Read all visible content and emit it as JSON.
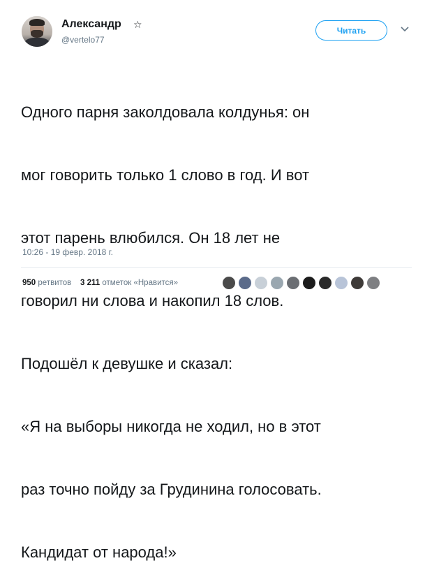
{
  "tweet": {
    "author_name": "Александр",
    "verified_icon": "☆",
    "handle": "@vertelo77",
    "follow_label": "Читать",
    "text_lines": [
      "Одного парня заколдовала колдунья: он",
      "мог говорить только 1 слово в год. И вот",
      "этот парень влюбился. Он 18 лет не",
      "говорил ни слова и накопил 18 слов.",
      "Подошёл к девушке и сказал:",
      "«Я на выборы никогда не ходил, но в этот",
      "раз точно пойду за Грудинина голосовать.",
      "Кандидат от народа!»"
    ],
    "timestamp": "10:26 - 19 февр. 2018 г.",
    "retweets_count": "950",
    "retweets_label": "ретвитов",
    "likes_count": "3 211",
    "likes_label": "отметок «Нравится»"
  },
  "colors": {
    "accent": "#1da1f2",
    "text": "#14171a",
    "muted": "#657786",
    "divider": "#e6ecf0"
  },
  "likers": [
    {
      "color": "#4a4a4a"
    },
    {
      "color": "#5b6b8a"
    },
    {
      "color": "#c8d0d8"
    },
    {
      "color": "#9aa7b0"
    },
    {
      "color": "#6b6e73"
    },
    {
      "color": "#1c1c1c"
    },
    {
      "color": "#2a2a2a"
    },
    {
      "color": "#b8c4d8"
    },
    {
      "color": "#3e3a38"
    },
    {
      "color": "#7e7f82"
    }
  ]
}
